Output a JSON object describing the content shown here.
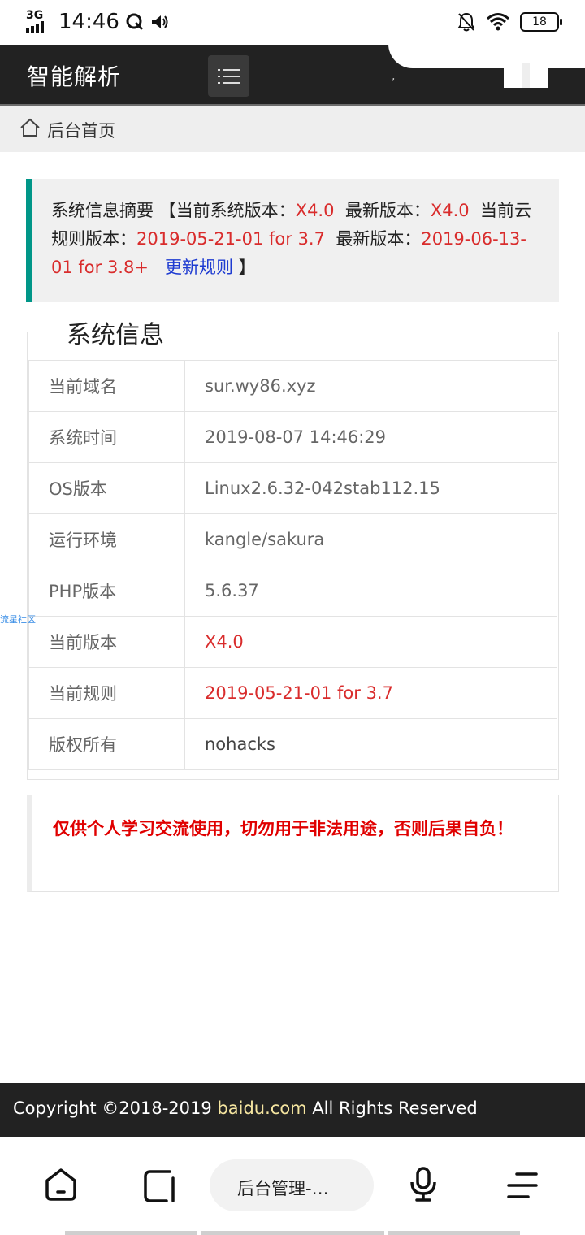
{
  "status_bar": {
    "network": "3G",
    "time": "14:46",
    "battery": "18"
  },
  "header": {
    "brand": "智能解析"
  },
  "breadcrumb": {
    "label": "后台首页"
  },
  "notice": {
    "summary_label": "系统信息摘要",
    "open_bracket": "【",
    "current_version_label": "当前系统版本：",
    "current_version": "X4.0",
    "latest_version_label": "最新版本：",
    "latest_version": "X4.0",
    "cloud_rule_label": "当前云规则版本：",
    "cloud_rule": "2019-05-21-01 for 3.7",
    "latest_rule_label": "最新版本：",
    "latest_rule": "2019-06-13-01 for 3.8+",
    "update_link": "更新规则",
    "close_bracket": "】"
  },
  "system_info": {
    "legend": "系统信息",
    "rows": [
      {
        "key": "当前域名",
        "value": "sur.wy86.xyz"
      },
      {
        "key": "系统时间",
        "value": "2019-08-07 14:46:29"
      },
      {
        "key": "OS版本",
        "value": "Linux2.6.32-042stab112.15"
      },
      {
        "key": "运行环境",
        "value": "kangle/sakura"
      },
      {
        "key": "PHP版本",
        "value": "5.6.37"
      },
      {
        "key": "当前版本",
        "value": "X4.0"
      },
      {
        "key": "当前规则",
        "value": "2019-05-21-01 for 3.7"
      },
      {
        "key": "版权所有",
        "value": "nohacks"
      }
    ]
  },
  "watermark": "流星社区",
  "warning": {
    "text": "仅供个人学习交流使用，切勿用于非法用途，否则后果自负！"
  },
  "footer": {
    "prefix": "Copyright ©2018-2019 ",
    "link": "baidu.com",
    "suffix": " All Rights Reserved"
  },
  "browser_bar": {
    "url_title": "后台管理-…"
  },
  "colors": {
    "header_bg": "#222222",
    "accent_teal": "#009688",
    "highlight_red": "#d92c2c",
    "link_blue": "#1e3bd1",
    "warning_red": "#e00000"
  }
}
